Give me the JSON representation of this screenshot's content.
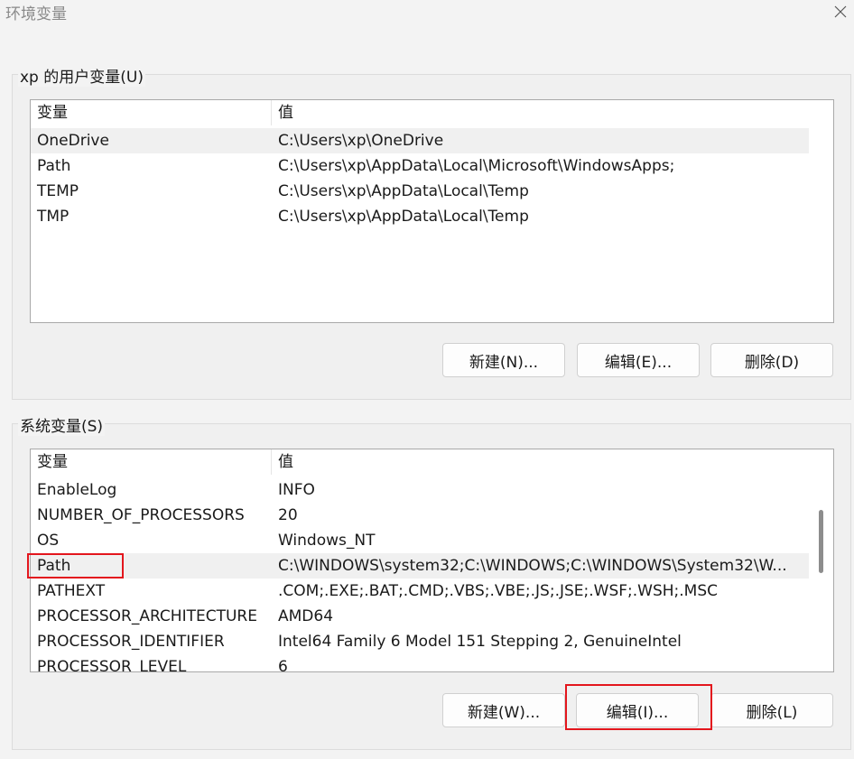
{
  "window": {
    "title": "环境变量",
    "close_icon": "close-icon"
  },
  "user_group": {
    "legend": "xp 的用户变量(U)",
    "columns": [
      "变量",
      "值"
    ],
    "rows": [
      {
        "name": "OneDrive",
        "value": "C:\\Users\\xp\\OneDrive"
      },
      {
        "name": "Path",
        "value": "C:\\Users\\xp\\AppData\\Local\\Microsoft\\WindowsApps;"
      },
      {
        "name": "TEMP",
        "value": "C:\\Users\\xp\\AppData\\Local\\Temp"
      },
      {
        "name": "TMP",
        "value": "C:\\Users\\xp\\AppData\\Local\\Temp"
      }
    ],
    "selected_index": 0,
    "buttons": {
      "new": "新建(N)...",
      "edit": "编辑(E)...",
      "delete": "删除(D)"
    }
  },
  "system_group": {
    "legend": "系统变量(S)",
    "columns": [
      "变量",
      "值"
    ],
    "rows": [
      {
        "name": "EnableLog",
        "value": "INFO"
      },
      {
        "name": "NUMBER_OF_PROCESSORS",
        "value": "20"
      },
      {
        "name": "OS",
        "value": "Windows_NT"
      },
      {
        "name": "Path",
        "value": "C:\\WINDOWS\\system32;C:\\WINDOWS;C:\\WINDOWS\\System32\\W..."
      },
      {
        "name": "PATHEXT",
        "value": ".COM;.EXE;.BAT;.CMD;.VBS;.VBE;.JS;.JSE;.WSF;.WSH;.MSC"
      },
      {
        "name": "PROCESSOR_ARCHITECTURE",
        "value": "AMD64"
      },
      {
        "name": "PROCESSOR_IDENTIFIER",
        "value": "Intel64 Family 6 Model 151 Stepping 2, GenuineIntel"
      },
      {
        "name": "PROCESSOR_LEVEL",
        "value": "6"
      }
    ],
    "selected_index": 3,
    "buttons": {
      "new": "新建(W)...",
      "edit": "编辑(I)...",
      "delete": "删除(L)"
    }
  },
  "colors": {
    "highlight": "#e3161d",
    "selected_row": "#f0f0f0"
  }
}
